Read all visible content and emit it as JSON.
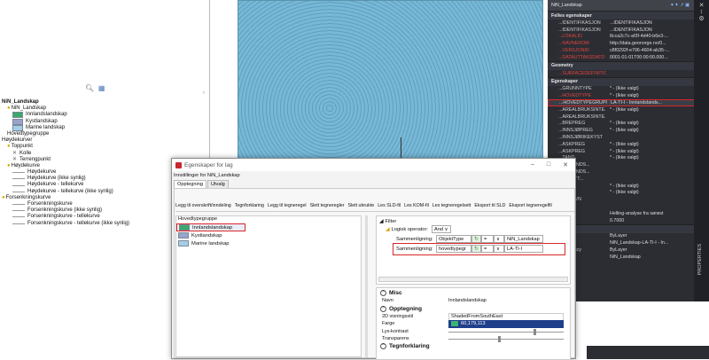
{
  "left_panel": {
    "tree": [
      {
        "t": "NiN_Landskap",
        "i": 0,
        "ic": "none",
        "bold": true
      },
      {
        "t": "NiN_Landskap",
        "i": 1,
        "ic": "pin"
      },
      {
        "t": "Innlandslandskap",
        "i": 2,
        "ic": "swatch",
        "c": "#3ca86b"
      },
      {
        "t": "Kystlandskap",
        "i": 2,
        "ic": "swatch",
        "c": "#9aa3c9"
      },
      {
        "t": "Marine landskap",
        "i": 2,
        "ic": "swatch",
        "c": "#a6cfe6"
      },
      {
        "t": "Hovedtypegruppe",
        "i": 1,
        "ic": "none"
      },
      {
        "t": "Høydekurver",
        "i": 0,
        "ic": "none"
      },
      {
        "t": "Toppunkt",
        "i": 1,
        "ic": "pin"
      },
      {
        "t": "Kolle",
        "i": 2,
        "ic": "x"
      },
      {
        "t": "Terrengpunkt",
        "i": 2,
        "ic": "x"
      },
      {
        "t": "Høydekurve",
        "i": 1,
        "ic": "pin"
      },
      {
        "t": "Høydekurve",
        "i": 2,
        "ic": "dash"
      },
      {
        "t": "Høydekurve (ikke synlig)",
        "i": 2,
        "ic": "dash"
      },
      {
        "t": "Høydekurve - tellekurve",
        "i": 2,
        "ic": "dash"
      },
      {
        "t": "Høydekurve - tellekurve (ikke synlig)",
        "i": 2,
        "ic": "dash"
      },
      {
        "t": "Forsenkningskurve",
        "i": 0,
        "ic": "pin"
      },
      {
        "t": "Forsenkningskurve",
        "i": 2,
        "ic": "dash"
      },
      {
        "t": "Forsenkningskurve (ikke synlig)",
        "i": 2,
        "ic": "dash"
      },
      {
        "t": "Forsenkningskurve - tellekurve",
        "i": 2,
        "ic": "dash"
      },
      {
        "t": "Forsenkningskurve - tellekurve (ikke synlig)",
        "i": 2,
        "ic": "dash"
      }
    ]
  },
  "props": {
    "layer": "NiN_Landskap",
    "sections": [
      {
        "title": "Felles egenskaper",
        "rows": [
          {
            "k": "...IDENTIFIKASJON",
            "v": "...IDENTIFIKASJON",
            "dim": true
          },
          {
            "k": "...IDENTIFIKASJON",
            "v": "...IDENTIFIKASJON",
            "dim": true
          },
          {
            "k": "...LOKALID",
            "v": "8cca2c7c-af3f-4d40-b6e3-...",
            "red": true
          },
          {
            "k": "...NAVNEROM",
            "v": "http://data.geonorge.no/0...",
            "red": true
          },
          {
            "k": "...VERSJONID",
            "v": "c8f0292f-e706-4604-ab35-...",
            "red": true
          },
          {
            "k": "...DATAUTTAKSDATO",
            "v": "0001-01-01T00:00:00.000...",
            "red": true
          }
        ]
      },
      {
        "title": "Geometry",
        "rows": [
          {
            "k": "...SURFACEDEFINITION",
            "v": "",
            "red": true
          }
        ]
      },
      {
        "title": "Egenskaper",
        "rows": [
          {
            "k": "...GRUNNTYPE",
            "v": "* - (Ikke valgt)"
          },
          {
            "k": "...HOVEDTYPE",
            "v": "* - (Ikke valgt)",
            "red": true
          },
          {
            "k": "...HOVEDTYPEGRUPPE",
            "v": "LA-TI-I - Innlandslands...",
            "hl": true
          },
          {
            "k": "...AREALBRUKSINTE...",
            "v": "* - (Ikke valgt)"
          },
          {
            "k": "...AREALBRUKSINTE...",
            "v": ""
          },
          {
            "k": "...BREPREG",
            "v": "* - (Ikke valgt)"
          },
          {
            "k": "...INNSJØPREG",
            "v": "* - (Ikke valgt)"
          },
          {
            "k": "...INNSJØRIKEKYST",
            "v": ""
          },
          {
            "k": "...ÅSKPREG",
            "v": "* - (Ikke valgt)"
          },
          {
            "k": "...ÅSKPREG",
            "v": "* - (Ikke valgt)"
          },
          {
            "k": "...TAND",
            "v": "* - (Ikke valgt)"
          },
          {
            "k": "...INNLANDS...",
            "v": ""
          },
          {
            "k": "...INNLANDS...",
            "v": ""
          },
          {
            "k": "...SSLETT...",
            "v": ""
          },
          {
            "k": "...PREG",
            "v": "* - (Ikke valgt)"
          },
          {
            "k": "...PREG",
            "v": "* - (Ikke valgt)"
          },
          {
            "k": "...PENAVN",
            "v": ""
          },
          {
            "k": "",
            "v": ""
          },
          {
            "k": "...ight",
            "v": "Helling-analyse fra sørøst"
          },
          {
            "k": "...cy",
            "v": "0.7000"
          }
        ]
      },
      {
        "title": "General",
        "rows": [
          {
            "k": "",
            "v": "ByLayer"
          },
          {
            "k": "",
            "v": "NiN_Landskap-LA-TI-I - In..."
          },
          {
            "k": "...sparency",
            "v": "ByLayer"
          },
          {
            "k": "...ment",
            "v": "NiN_Landskap"
          }
        ]
      }
    ],
    "side_label": "PROPERTIES"
  },
  "dialog": {
    "title": "Egenskaper for lag",
    "subtitle": "Innstillinger for NiN_Landskap",
    "tabs": [
      "Opptegning",
      "Utvalg"
    ],
    "toolbar": [
      "Legg til overskrift/inndeling",
      "Tegnforklaring",
      "Legg til tegneregel",
      "Slett tegneregler",
      "Slett ubrukte",
      "Les SLD-fil",
      "Les KOM-fil",
      "Les tegneregelsett",
      "Eksport til SLD",
      "Eksport tegneregelfil"
    ],
    "list_header": "Hovedtypegruppe",
    "items": [
      {
        "t": "Innlandslandskap",
        "c": "#3ca86b",
        "sel": true
      },
      {
        "t": "Kystlandskap",
        "c": "#9aa3c9"
      },
      {
        "t": "Marine landskap",
        "c": "#a6cfe6"
      }
    ],
    "filter": {
      "title": "Filter",
      "op_label": "Logisk operator:",
      "op": "And",
      "cmp_label": "Sammenligning:",
      "rows": [
        {
          "field": "ObjektType",
          "eq": "=",
          "val": "NiN_Landskap"
        },
        {
          "field": "hovedtypegr",
          "eq": "=",
          "val": "LA-TI-I"
        }
      ]
    },
    "props": {
      "misc_title": "Misc",
      "navn_k": "Navn",
      "navn_v": "Innlandslandskap",
      "opp_title": "Opptegning",
      "vis_k": "2D visningsstil",
      "vis_v": "ShadedFromSouthEast",
      "farge_k": "Farge",
      "farge_v": "60,179,113",
      "farge_c": "#3cb371",
      "lys_k": "Lys-kontrast",
      "trans_k": "Transparens",
      "tegn_title": "Tegnforklaring"
    }
  }
}
